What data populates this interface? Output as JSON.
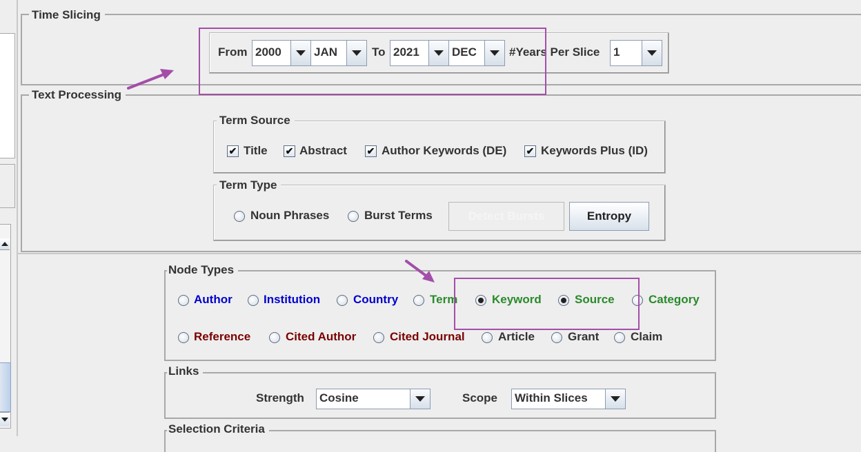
{
  "time_slicing": {
    "legend": "Time Slicing",
    "from_label": "From",
    "from_year": "2000",
    "from_month": "JAN",
    "to_label": "To",
    "to_year": "2021",
    "to_month": "DEC",
    "years_per_slice_label": "#Years Per Slice",
    "years_per_slice": "1"
  },
  "text_processing": {
    "legend": "Text Processing",
    "term_source": {
      "legend": "Term Source",
      "items": [
        {
          "label": "Title",
          "checked": true
        },
        {
          "label": "Abstract",
          "checked": true
        },
        {
          "label": "Author Keywords (DE)",
          "checked": true
        },
        {
          "label": "Keywords Plus (ID)",
          "checked": true
        }
      ]
    },
    "term_type": {
      "legend": "Term Type",
      "noun_phrases": "Noun Phrases",
      "burst_terms": "Burst Terms",
      "detect_bursts": "Detect Bursts",
      "entropy": "Entropy"
    }
  },
  "node_types": {
    "legend": "Node Types",
    "row1": [
      {
        "label": "Author",
        "selected": false,
        "color": "#0000cc"
      },
      {
        "label": "Institution",
        "selected": false,
        "color": "#0000cc"
      },
      {
        "label": "Country",
        "selected": false,
        "color": "#0000cc"
      },
      {
        "label": "Term",
        "selected": false,
        "color": "#2a8a2a"
      },
      {
        "label": "Keyword",
        "selected": true,
        "color": "#2a8a2a"
      },
      {
        "label": "Source",
        "selected": true,
        "color": "#2a8a2a"
      },
      {
        "label": "Category",
        "selected": false,
        "color": "#2a8a2a"
      }
    ],
    "row2": [
      {
        "label": "Reference",
        "selected": false,
        "color": "#7a0000"
      },
      {
        "label": "Cited Author",
        "selected": false,
        "color": "#7a0000"
      },
      {
        "label": "Cited Journal",
        "selected": false,
        "color": "#7a0000"
      },
      {
        "label": "Article",
        "selected": false,
        "color": "#333333"
      },
      {
        "label": "Grant",
        "selected": false,
        "color": "#333333"
      },
      {
        "label": "Claim",
        "selected": false,
        "color": "#333333"
      }
    ]
  },
  "links": {
    "legend": "Links",
    "strength_label": "Strength",
    "strength_value": "Cosine",
    "scope_label": "Scope",
    "scope_value": "Within Slices"
  },
  "selection_criteria": {
    "legend": "Selection Criteria"
  },
  "annotation_color": "#a34ea8"
}
